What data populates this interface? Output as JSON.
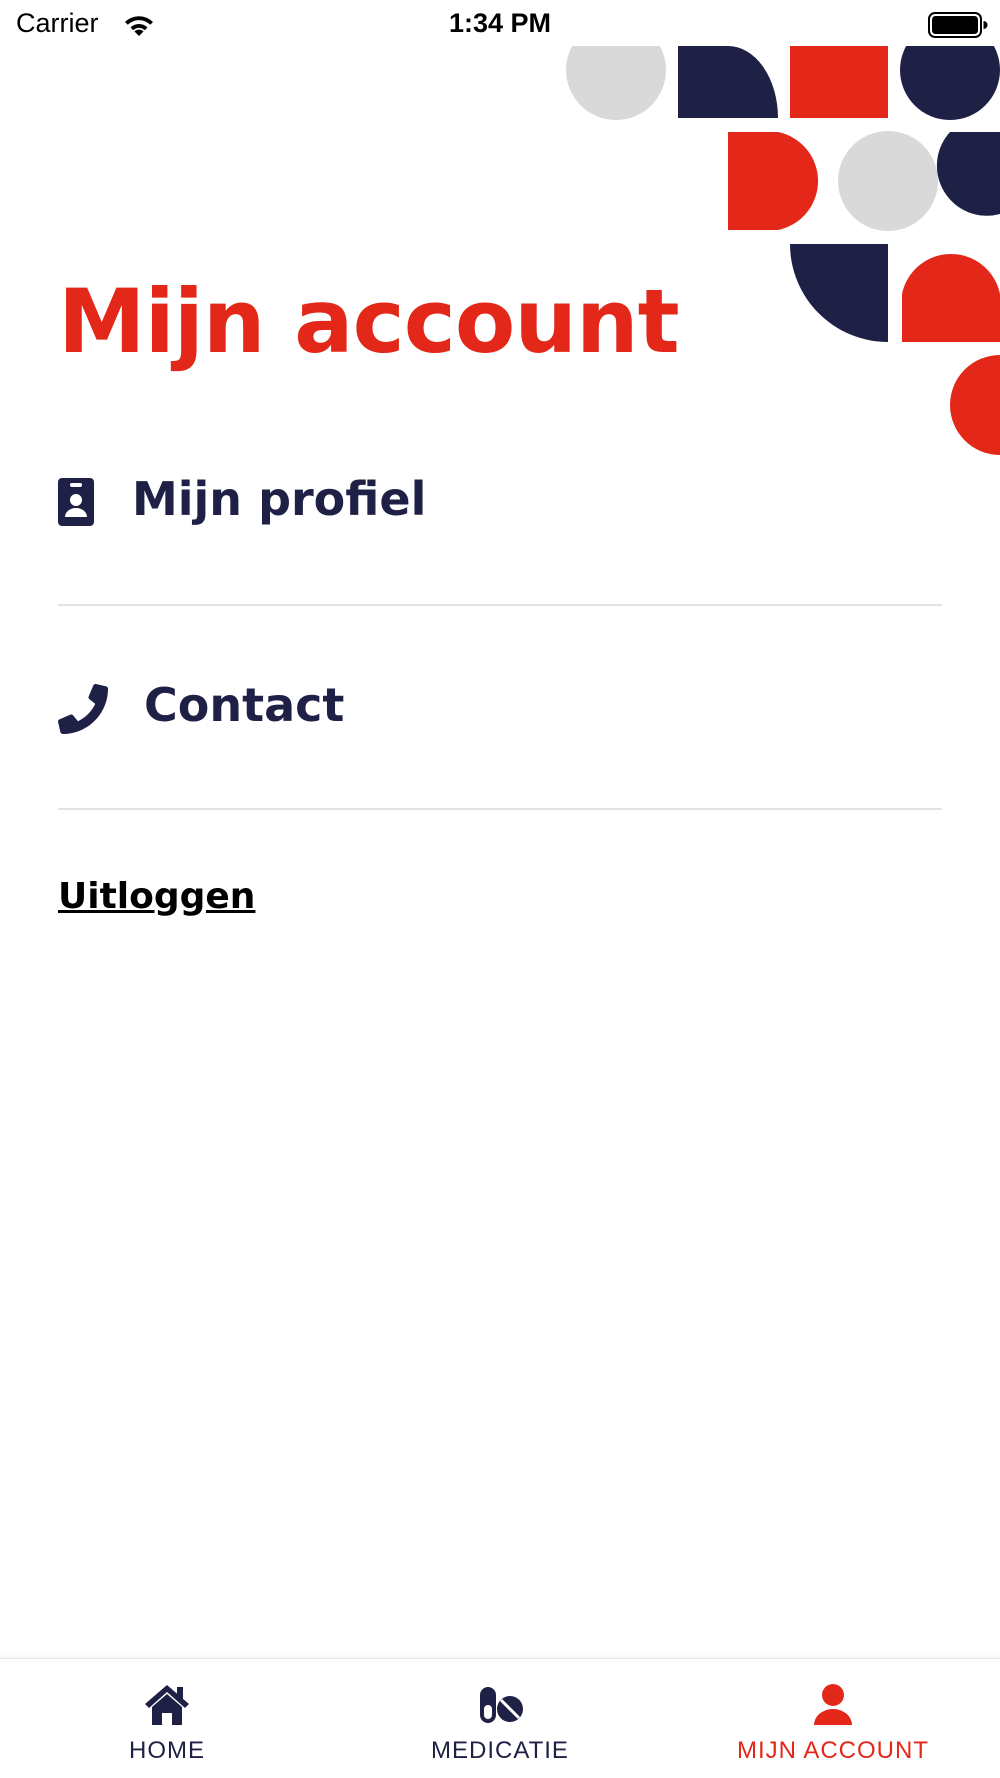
{
  "status_bar": {
    "carrier": "Carrier",
    "time": "1:34 PM"
  },
  "page": {
    "title": "Mijn account"
  },
  "menu": {
    "items": [
      {
        "label": "Mijn profiel",
        "icon": "id-badge-icon"
      },
      {
        "label": "Contact",
        "icon": "phone-icon"
      }
    ],
    "logout_label": "Uitloggen"
  },
  "tab_bar": {
    "tabs": [
      {
        "label": "HOME",
        "icon": "home-icon",
        "active": false
      },
      {
        "label": "MEDICATIE",
        "icon": "pills-icon",
        "active": false
      },
      {
        "label": "MIJN ACCOUNT",
        "icon": "user-icon",
        "active": true
      }
    ]
  },
  "colors": {
    "brand_red": "#e3281a",
    "brand_navy": "#1f2046",
    "pattern_gray": "#d9d9d9",
    "divider": "#e2e2e2"
  }
}
